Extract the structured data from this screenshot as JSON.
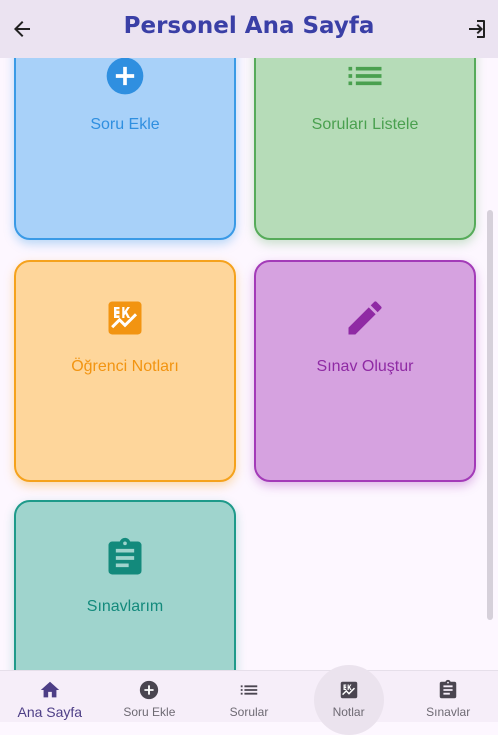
{
  "appbar": {
    "title": "Personel Ana Sayfa",
    "back_icon": "arrow-left-icon",
    "logout_icon": "logout-icon"
  },
  "cards": [
    {
      "label": "Soru Ekle",
      "icon": "add-circle-icon",
      "color": "#2f8fe0"
    },
    {
      "label": "Soruları Listele",
      "icon": "list-icon",
      "color": "#4aa04f"
    },
    {
      "label": "Öğrenci Notları",
      "icon": "grades-icon",
      "color": "#f29411"
    },
    {
      "label": "Sınav Oluştur",
      "icon": "pencil-icon",
      "color": "#8f2aa4"
    },
    {
      "label": "Sınavlarım",
      "icon": "clipboard-icon",
      "color": "#138a7c"
    }
  ],
  "bottom_nav": [
    {
      "label": "Ana Sayfa",
      "icon": "home-icon",
      "active": true
    },
    {
      "label": "Soru Ekle",
      "icon": "add-circle-icon",
      "active": false
    },
    {
      "label": "Sorular",
      "icon": "list-icon",
      "active": false
    },
    {
      "label": "Notlar",
      "icon": "grades-icon",
      "active": false
    },
    {
      "label": "Sınavlar",
      "icon": "clipboard-icon",
      "active": false
    }
  ]
}
